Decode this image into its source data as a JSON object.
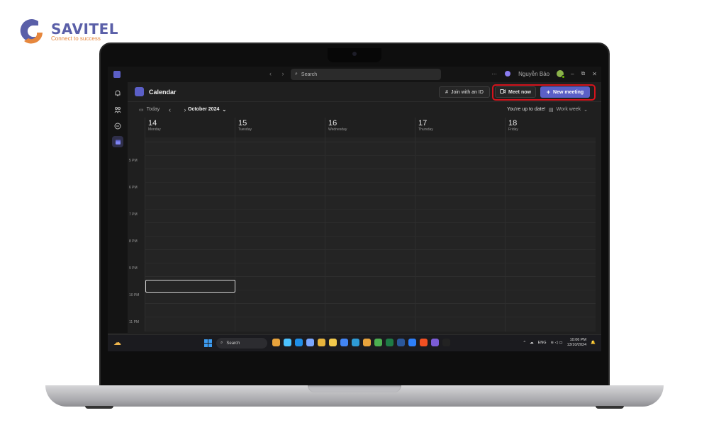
{
  "brand": {
    "name": "SAVITEL",
    "tagline": "Connect to success",
    "colors": {
      "primary": "#5a5fa8",
      "accent": "#e6873d"
    }
  },
  "titlebar": {
    "search_placeholder": "Search",
    "user_name": "Nguyễn Bảo",
    "more_label": "···",
    "minimize": "–",
    "restore": "⧉",
    "close": "✕"
  },
  "rail": [
    {
      "icon": "bell-icon"
    },
    {
      "icon": "people-icon"
    },
    {
      "icon": "chat-icon"
    },
    {
      "icon": "calendar-icon",
      "active": true
    }
  ],
  "calendar": {
    "title": "Calendar",
    "join_label": "Join with an ID",
    "meet_now_label": "Meet now",
    "new_meeting_label": "New meeting",
    "today_label": "Today",
    "month_label": "October 2024",
    "status_text": "You're up to date!",
    "view_label": "Work week",
    "days": [
      {
        "num": "14",
        "name": "Monday"
      },
      {
        "num": "15",
        "name": "Tuesday"
      },
      {
        "num": "16",
        "name": "Wednesday"
      },
      {
        "num": "17",
        "name": "Thursday"
      },
      {
        "num": "18",
        "name": "Friday"
      }
    ],
    "times": [
      "5 PM",
      "6 PM",
      "7 PM",
      "8 PM",
      "9 PM",
      "10 PM",
      "11 PM"
    ],
    "accent_color": "#5b5fc7",
    "highlight_color": "#d4141c"
  },
  "taskbar": {
    "search_label": "Search",
    "tray_lang": "ENG",
    "time": "10:06 PM",
    "date": "13/10/2024",
    "apps": [
      "#e8a33c",
      "#4cc2ff",
      "#1f8fe8",
      "#7aa7ff",
      "#e8b43c",
      "#f2c94c",
      "#4285f4",
      "#2e9bd6",
      "#e8a33c",
      "#4caf50",
      "#1e7b45",
      "#2b579a",
      "#2d7ff9",
      "#f25022",
      "#7b5cd6",
      "#222222"
    ]
  }
}
